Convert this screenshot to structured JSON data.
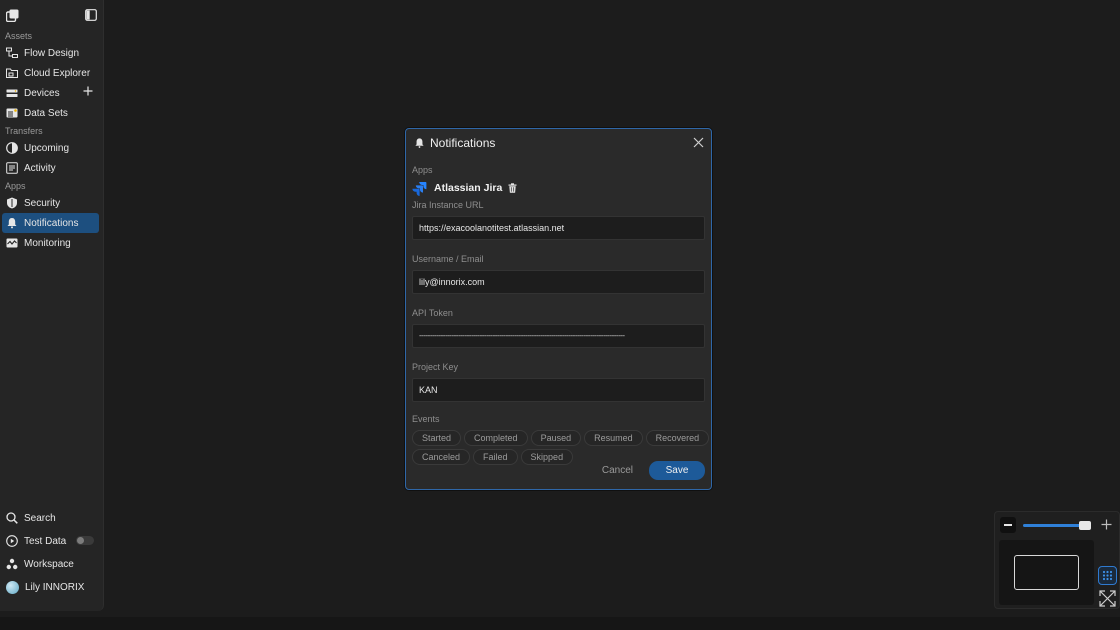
{
  "sidebar": {
    "sections": {
      "assets": "Assets",
      "transfers": "Transfers",
      "apps": "Apps"
    },
    "items": {
      "flow_design": "Flow Design",
      "cloud_explorer": "Cloud Explorer",
      "devices": "Devices",
      "data_sets": "Data Sets",
      "upcoming": "Upcoming",
      "activity": "Activity",
      "security": "Security",
      "notifications": "Notifications",
      "monitoring": "Monitoring"
    },
    "bottom": {
      "search": "Search",
      "test_data": "Test Data",
      "test_data_enabled": false,
      "workspace": "Workspace",
      "user": "Lily INNORIX"
    }
  },
  "dialog": {
    "title": "Notifications",
    "apps_label": "Apps",
    "app_name": "Atlassian Jira",
    "fields": {
      "url_label": "Jira Instance URL",
      "url_value": "https://exacoolanotitest.atlassian.net",
      "user_label": "Username / Email",
      "user_value": "lily@innorix.com",
      "token_label": "API Token",
      "token_value": "-----------------------------------------------------------------------------------------------",
      "project_label": "Project Key",
      "project_value": "KAN"
    },
    "events_label": "Events",
    "events": [
      "Started",
      "Completed",
      "Paused",
      "Resumed",
      "Recovered",
      "Canceled",
      "Failed",
      "Skipped"
    ],
    "cancel": "Cancel",
    "save": "Save"
  },
  "zoom": {
    "level": 0.95
  },
  "colors": {
    "accent": "#1d5a99",
    "active_nav": "#1d4f7f",
    "dialog_border": "#2f67a8"
  },
  "icons": {
    "logo": "app-logo-icon",
    "panel": "sidebar-toggle-icon",
    "bell": "bell-icon",
    "jira": "jira-icon",
    "trash": "trash-icon",
    "close": "close-icon"
  }
}
